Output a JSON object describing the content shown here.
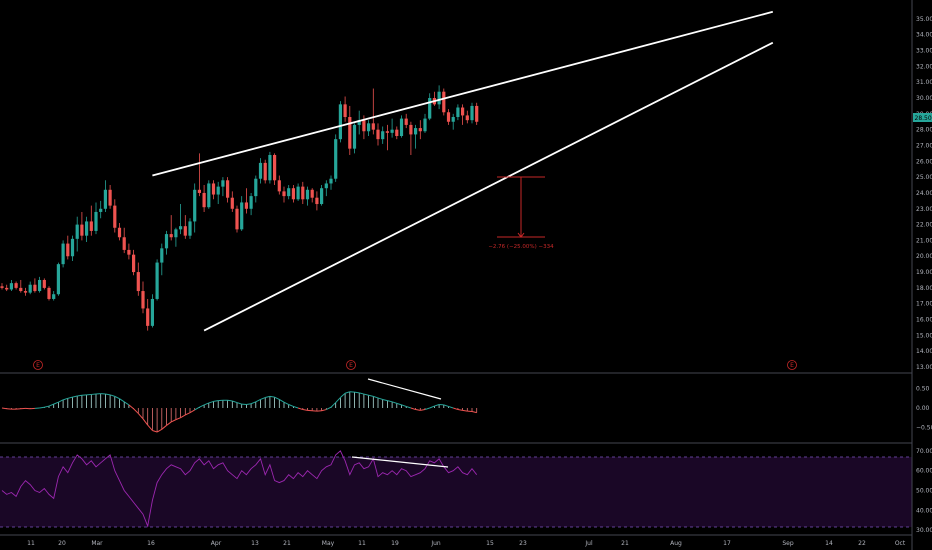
{
  "chart_data": [
    {
      "type": "candlestick",
      "ylim": [
        13,
        35.5
      ],
      "yticks": [
        "35.00",
        "34.00",
        "33.00",
        "32.00",
        "31.00",
        "30.00",
        "29.00",
        "28.00",
        "27.00",
        "26.00",
        "25.00",
        "24.00",
        "23.00",
        "22.00",
        "21.00",
        "20.00",
        "19.00",
        "18.00",
        "17.00",
        "16.00",
        "15.00",
        "14.00",
        "13.00"
      ],
      "last_price": "28.50",
      "colors": {
        "up": "#26a69a",
        "down": "#ef5350",
        "trendline": "#ffffff",
        "measure": "#c62828",
        "price_tag": "#26a69a"
      },
      "candles": [
        [
          18.1,
          18.3,
          17.9,
          18.0
        ],
        [
          18.0,
          18.2,
          17.8,
          17.9
        ],
        [
          17.9,
          18.5,
          17.8,
          18.3
        ],
        [
          18.3,
          18.4,
          17.9,
          18.0
        ],
        [
          18.0,
          18.5,
          17.7,
          17.8
        ],
        [
          17.8,
          18.0,
          17.5,
          17.7
        ],
        [
          17.7,
          18.4,
          17.6,
          18.2
        ],
        [
          18.2,
          18.6,
          17.7,
          17.8
        ],
        [
          17.8,
          18.7,
          17.7,
          18.5
        ],
        [
          18.5,
          18.6,
          17.9,
          18.0
        ],
        [
          18.0,
          18.1,
          17.2,
          17.3
        ],
        [
          17.3,
          17.8,
          17.2,
          17.6
        ],
        [
          17.6,
          19.6,
          17.5,
          19.5
        ],
        [
          19.5,
          21.0,
          19.3,
          20.8
        ],
        [
          20.8,
          21.3,
          19.8,
          20.0
        ],
        [
          20.0,
          21.3,
          19.7,
          21.1
        ],
        [
          21.1,
          22.5,
          20.3,
          22.0
        ],
        [
          22.0,
          22.8,
          21.0,
          21.3
        ],
        [
          21.3,
          22.5,
          20.9,
          22.2
        ],
        [
          22.2,
          23.2,
          21.3,
          21.6
        ],
        [
          21.6,
          23.4,
          21.4,
          22.8
        ],
        [
          22.8,
          23.5,
          22.4,
          23.0
        ],
        [
          23.0,
          24.8,
          22.8,
          24.2
        ],
        [
          24.2,
          24.5,
          23.0,
          23.2
        ],
        [
          23.2,
          23.6,
          21.5,
          21.8
        ],
        [
          21.8,
          22.1,
          21.0,
          21.2
        ],
        [
          21.2,
          21.8,
          20.2,
          20.4
        ],
        [
          20.4,
          20.8,
          19.8,
          20.1
        ],
        [
          20.1,
          20.4,
          18.8,
          19.0
        ],
        [
          19.0,
          19.6,
          17.5,
          17.8
        ],
        [
          17.8,
          18.4,
          16.4,
          16.7
        ],
        [
          16.7,
          17.3,
          15.3,
          15.6
        ],
        [
          15.6,
          17.6,
          15.5,
          17.3
        ],
        [
          17.3,
          19.8,
          17.2,
          19.6
        ],
        [
          19.6,
          20.8,
          18.8,
          20.5
        ],
        [
          20.5,
          21.6,
          20.1,
          21.4
        ],
        [
          21.4,
          22.6,
          21.0,
          21.2
        ],
        [
          21.2,
          21.8,
          20.6,
          21.7
        ],
        [
          21.7,
          23.3,
          21.4,
          21.9
        ],
        [
          21.9,
          22.6,
          21.1,
          21.3
        ],
        [
          21.3,
          22.4,
          21.1,
          22.2
        ],
        [
          22.2,
          24.6,
          21.5,
          24.2
        ],
        [
          24.2,
          26.5,
          23.8,
          24.0
        ],
        [
          24.0,
          24.5,
          22.8,
          23.1
        ],
        [
          23.1,
          24.8,
          23.0,
          24.6
        ],
        [
          24.6,
          24.8,
          23.6,
          23.9
        ],
        [
          23.9,
          24.7,
          23.3,
          24.4
        ],
        [
          24.4,
          25.0,
          23.8,
          24.8
        ],
        [
          24.8,
          25.0,
          23.4,
          23.7
        ],
        [
          23.7,
          24.1,
          22.8,
          23.0
        ],
        [
          23.0,
          23.2,
          21.5,
          21.7
        ],
        [
          21.7,
          23.8,
          21.6,
          23.4
        ],
        [
          23.4,
          24.3,
          22.7,
          23.0
        ],
        [
          23.0,
          24.0,
          22.6,
          23.8
        ],
        [
          23.8,
          25.1,
          23.4,
          24.9
        ],
        [
          24.9,
          26.2,
          24.6,
          25.9
        ],
        [
          25.9,
          26.1,
          24.6,
          24.8
        ],
        [
          24.8,
          26.6,
          24.6,
          26.4
        ],
        [
          26.4,
          26.5,
          24.5,
          24.8
        ],
        [
          24.8,
          25.1,
          23.9,
          24.1
        ],
        [
          24.1,
          24.4,
          23.4,
          23.8
        ],
        [
          23.8,
          24.5,
          23.6,
          24.3
        ],
        [
          24.3,
          24.5,
          23.4,
          23.6
        ],
        [
          23.6,
          24.6,
          23.5,
          24.4
        ],
        [
          24.4,
          24.7,
          23.3,
          23.6
        ],
        [
          23.6,
          24.4,
          23.2,
          24.2
        ],
        [
          24.2,
          24.3,
          23.4,
          23.7
        ],
        [
          23.7,
          24.1,
          22.9,
          23.3
        ],
        [
          23.3,
          24.5,
          23.2,
          24.3
        ],
        [
          24.3,
          24.8,
          23.8,
          24.6
        ],
        [
          24.6,
          25.1,
          24.2,
          24.9
        ],
        [
          24.9,
          27.7,
          24.7,
          27.4
        ],
        [
          27.4,
          29.8,
          27.2,
          29.6
        ],
        [
          29.6,
          30.1,
          28.5,
          28.8
        ],
        [
          28.8,
          29.5,
          26.4,
          26.8
        ],
        [
          26.8,
          28.4,
          26.5,
          28.3
        ],
        [
          28.3,
          29.2,
          27.7,
          28.6
        ],
        [
          28.6,
          28.9,
          27.4,
          27.9
        ],
        [
          27.9,
          28.6,
          27.6,
          28.4
        ],
        [
          28.4,
          30.6,
          27.7,
          28.0
        ],
        [
          28.0,
          28.4,
          27.0,
          27.4
        ],
        [
          27.4,
          28.2,
          27.1,
          27.9
        ],
        [
          27.9,
          28.3,
          26.7,
          27.8
        ],
        [
          27.8,
          28.7,
          27.5,
          28.0
        ],
        [
          28.0,
          28.2,
          27.4,
          27.6
        ],
        [
          27.6,
          28.9,
          27.5,
          28.7
        ],
        [
          28.7,
          29.0,
          28.1,
          28.3
        ],
        [
          28.3,
          28.5,
          26.4,
          27.7
        ],
        [
          27.7,
          28.3,
          26.8,
          28.1
        ],
        [
          28.1,
          28.6,
          27.4,
          27.9
        ],
        [
          27.9,
          29.0,
          27.8,
          28.7
        ],
        [
          28.7,
          30.3,
          28.6,
          30.0
        ],
        [
          30.0,
          30.4,
          29.5,
          29.6
        ],
        [
          29.6,
          30.8,
          29.3,
          30.4
        ],
        [
          30.4,
          30.6,
          28.9,
          29.1
        ],
        [
          29.1,
          29.3,
          28.3,
          28.5
        ],
        [
          28.5,
          29.0,
          28.0,
          28.8
        ],
        [
          28.8,
          29.6,
          28.6,
          29.4
        ],
        [
          29.4,
          29.6,
          28.3,
          28.9
        ],
        [
          28.9,
          29.2,
          28.4,
          28.6
        ],
        [
          28.6,
          29.7,
          28.4,
          29.5
        ],
        [
          29.5,
          29.7,
          28.3,
          28.5
        ]
      ],
      "trendlines": [
        {
          "from": {
            "bar": 32,
            "price": 25.1
          },
          "to": {
            "bar": 164,
            "price": 35.45
          }
        },
        {
          "from": {
            "bar": 43,
            "price": 15.3
          },
          "to": {
            "bar": 164,
            "price": 33.5
          }
        }
      ],
      "measure_label": "−2.76 (−25.00%) −334",
      "events": [
        "E",
        "E",
        "E"
      ]
    },
    {
      "type": "macd-histogram",
      "ylim": [
        -0.8,
        0.8
      ],
      "yticks": [
        "0.50",
        "0.00",
        "−0.50"
      ],
      "values": [
        0.0,
        -0.02,
        -0.03,
        -0.03,
        -0.02,
        -0.01,
        -0.02,
        -0.01,
        0.0,
        0.02,
        0.05,
        0.1,
        0.15,
        0.21,
        0.25,
        0.28,
        0.31,
        0.33,
        0.34,
        0.35,
        0.36,
        0.37,
        0.36,
        0.34,
        0.3,
        0.24,
        0.16,
        0.08,
        -0.02,
        -0.14,
        -0.28,
        -0.44,
        -0.58,
        -0.62,
        -0.55,
        -0.45,
        -0.36,
        -0.3,
        -0.25,
        -0.18,
        -0.12,
        -0.05,
        0.02,
        0.08,
        0.13,
        0.17,
        0.19,
        0.2,
        0.2,
        0.18,
        0.14,
        0.1,
        0.09,
        0.11,
        0.16,
        0.22,
        0.27,
        0.3,
        0.28,
        0.22,
        0.15,
        0.09,
        0.04,
        0.0,
        -0.04,
        -0.06,
        -0.07,
        -0.08,
        -0.07,
        -0.04,
        0.02,
        0.14,
        0.27,
        0.38,
        0.42,
        0.41,
        0.39,
        0.36,
        0.33,
        0.3,
        0.26,
        0.22,
        0.19,
        0.16,
        0.12,
        0.08,
        0.04,
        0.0,
        -0.04,
        -0.06,
        -0.04,
        0.0,
        0.05,
        0.09,
        0.08,
        0.04,
        0.0,
        -0.04,
        -0.06,
        -0.08,
        -0.09,
        -0.12
      ]
    },
    {
      "type": "rsi-line",
      "ylim": [
        28,
        73
      ],
      "yticks": [
        "70.00",
        "60.00",
        "50.00",
        "40.00",
        "30.00"
      ],
      "values": [
        50,
        48,
        49,
        47,
        52,
        55,
        53,
        50,
        49,
        51,
        48,
        46,
        57,
        62,
        59,
        64,
        68,
        66,
        63,
        65,
        62,
        64,
        66,
        68,
        60,
        55,
        50,
        47,
        44,
        41,
        38,
        32,
        45,
        54,
        58,
        61,
        63,
        62,
        61,
        58,
        60,
        64,
        66,
        63,
        65,
        61,
        63,
        64,
        60,
        58,
        56,
        60,
        58,
        61,
        63,
        66,
        58,
        63,
        55,
        54,
        55,
        58,
        56,
        59,
        57,
        60,
        58,
        56,
        60,
        62,
        63,
        68,
        70,
        65,
        58,
        63,
        64,
        61,
        62,
        66,
        57,
        59,
        58,
        60,
        58,
        61,
        60,
        57,
        58,
        59,
        61,
        65,
        64,
        66,
        62,
        59,
        60,
        62,
        59,
        58,
        61,
        58
      ]
    }
  ],
  "x_axis": {
    "labels": [
      "11",
      "20",
      "Mar",
      "16",
      "Apr",
      "13",
      "21",
      "May",
      "11",
      "19",
      "Jun",
      "15",
      "23",
      "Jul",
      "21",
      "Aug",
      "17",
      "Sep",
      "14",
      "22",
      "Oct"
    ]
  }
}
